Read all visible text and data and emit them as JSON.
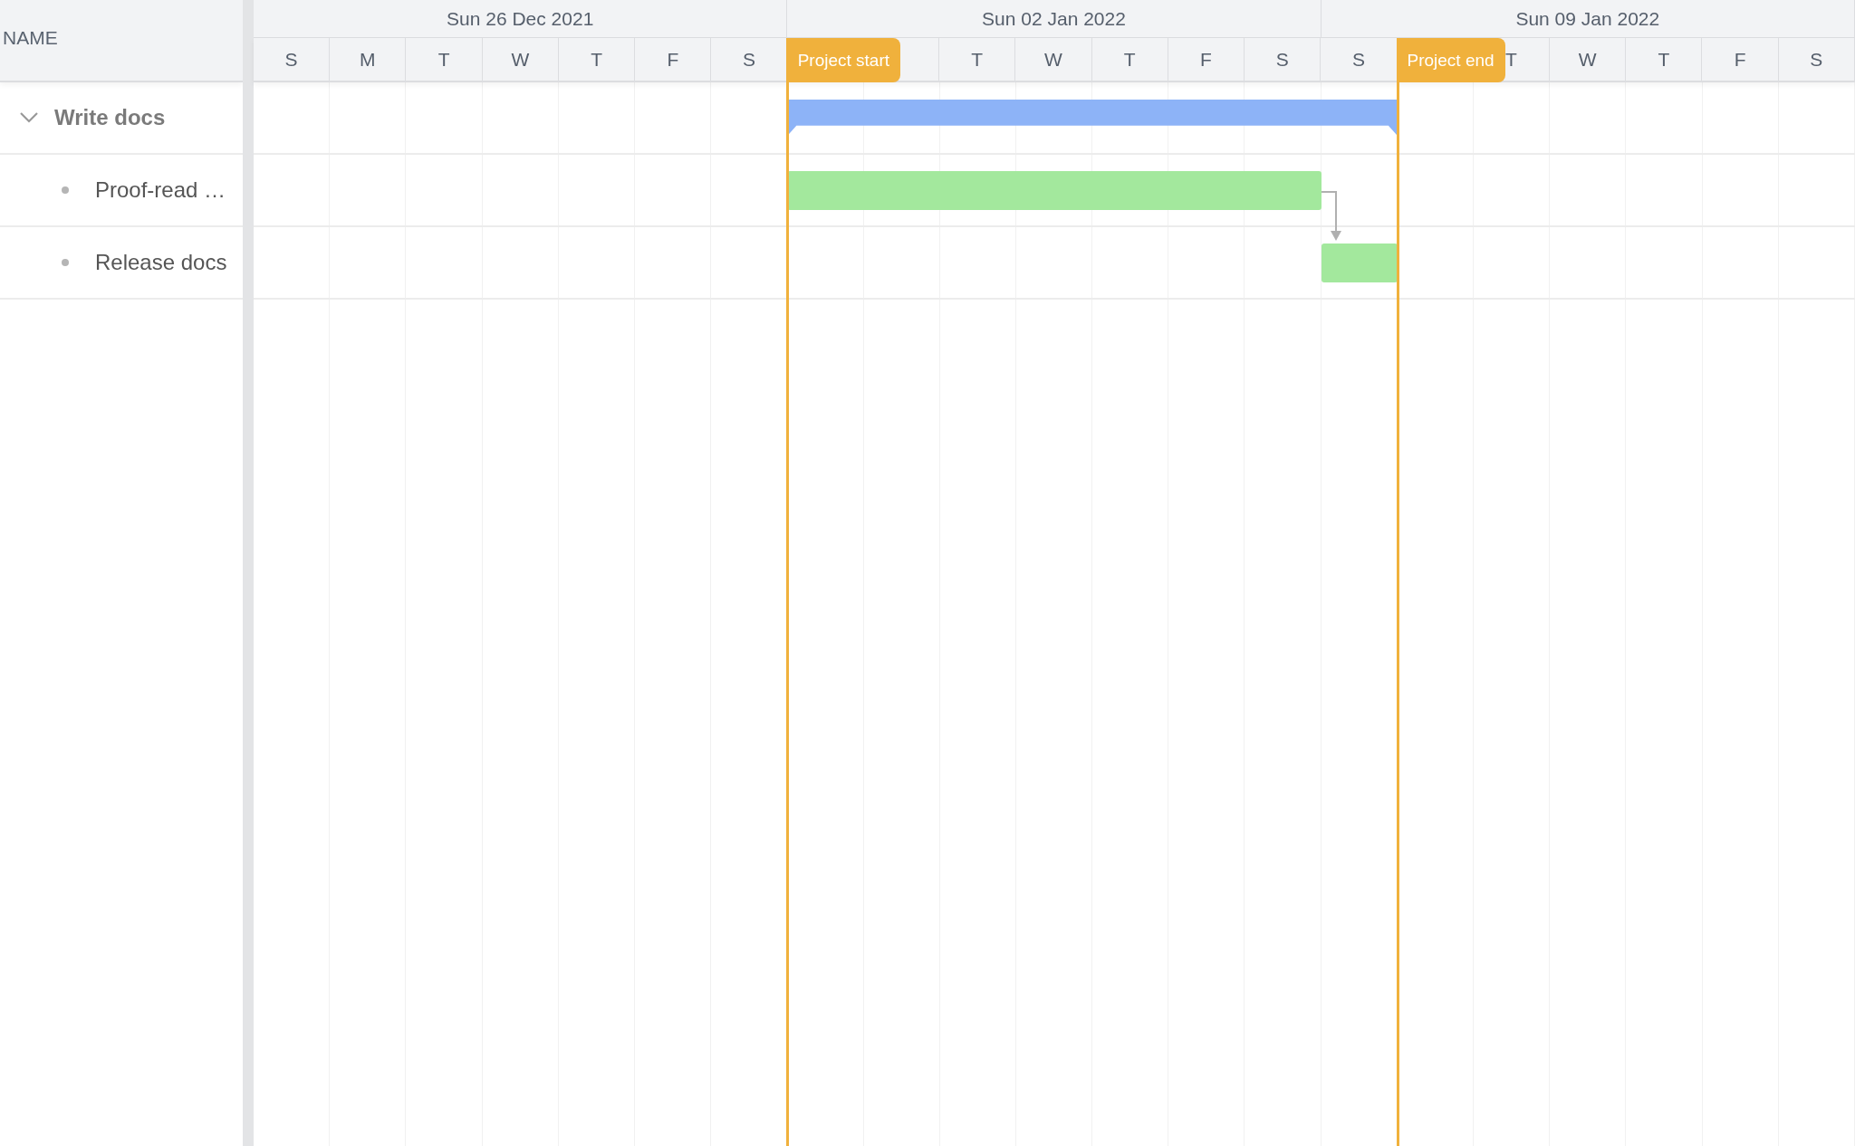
{
  "columns": {
    "name": "NAME"
  },
  "weeks": [
    {
      "label": "Sun 26 Dec 2021",
      "days": [
        {
          "kind": "day",
          "label": "S"
        },
        {
          "kind": "day",
          "label": "M"
        },
        {
          "kind": "day",
          "label": "T"
        },
        {
          "kind": "day",
          "label": "W"
        },
        {
          "kind": "day",
          "label": "T"
        },
        {
          "kind": "day",
          "label": "F"
        },
        {
          "kind": "day",
          "label": "S"
        }
      ]
    },
    {
      "label": "Sun 02 Jan 2022",
      "days": [
        {
          "kind": "marker",
          "label": "Project start"
        },
        {
          "kind": "day",
          "label": "T"
        },
        {
          "kind": "day",
          "label": "W"
        },
        {
          "kind": "day",
          "label": "T"
        },
        {
          "kind": "day",
          "label": "F"
        },
        {
          "kind": "day",
          "label": "S"
        }
      ]
    },
    {
      "label": "Sun 09 Jan 2022",
      "days": [
        {
          "kind": "day",
          "label": "S"
        },
        {
          "kind": "marker",
          "label": "Project end"
        },
        {
          "kind": "day",
          "label": "T"
        },
        {
          "kind": "day",
          "label": "W"
        },
        {
          "kind": "day",
          "label": "T"
        },
        {
          "kind": "day",
          "label": "F"
        },
        {
          "kind": "day",
          "label": "S"
        }
      ]
    }
  ],
  "tasks": [
    {
      "name": "Write docs",
      "kind": "summary",
      "expanded": true,
      "children": [
        {
          "name": "Proof-read …",
          "kind": "task"
        },
        {
          "name": "Release docs",
          "kind": "task"
        }
      ]
    }
  ]
}
